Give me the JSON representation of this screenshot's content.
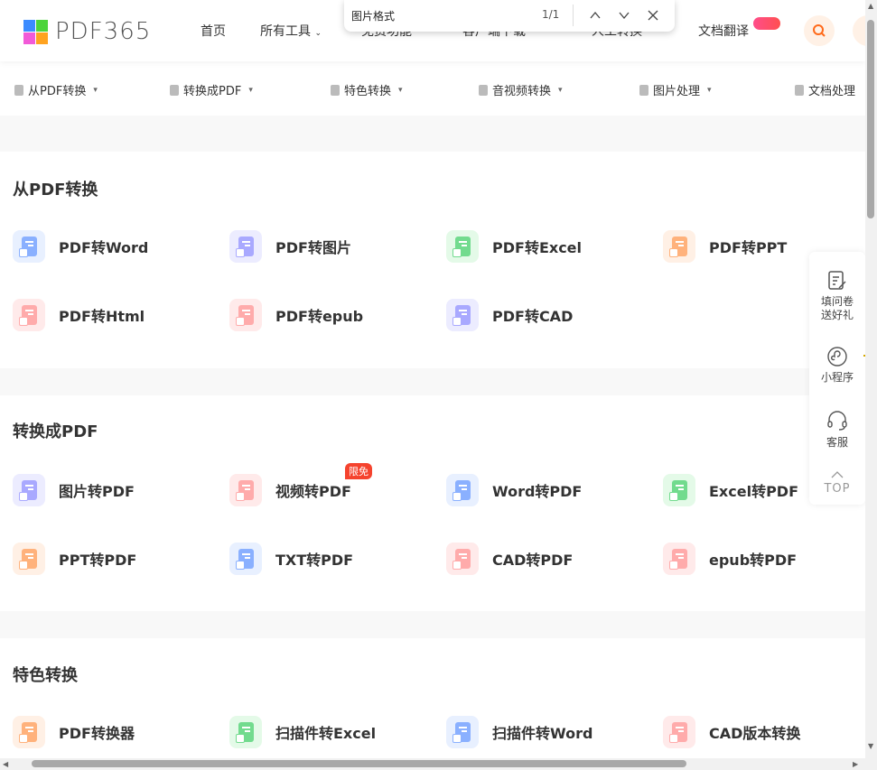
{
  "header": {
    "logo": "PDF365",
    "nav": [
      "首页",
      "所有工具",
      "免费功能",
      "客户端下载",
      "人工转换",
      "文档翻译"
    ]
  },
  "findbar": {
    "query": "图片格式",
    "count": "1/1"
  },
  "subnav": [
    "从PDF转换",
    "转换成PDF",
    "特色转换",
    "音视频转换",
    "图片处理",
    "文档处理"
  ],
  "sections": [
    {
      "title": "从PDF转换",
      "items": [
        {
          "label": "PDF转Word",
          "bg": "#e8f0ff",
          "fg": "#8ab0ff"
        },
        {
          "label": "PDF转图片",
          "bg": "#ececff",
          "fg": "#a9a9ff"
        },
        {
          "label": "PDF转Excel",
          "bg": "#e4fae8",
          "fg": "#72db8e"
        },
        {
          "label": "PDF转PPT",
          "bg": "#fff0e5",
          "fg": "#ffb27c"
        },
        {
          "label": "PDF转Html",
          "bg": "#ffeaea",
          "fg": "#ffabab"
        },
        {
          "label": "PDF转epub",
          "bg": "#ffeaea",
          "fg": "#ffabab"
        },
        {
          "label": "PDF转CAD",
          "bg": "#ececff",
          "fg": "#a9a9ff"
        }
      ]
    },
    {
      "title": "转换成PDF",
      "items": [
        {
          "label": "图片转PDF",
          "bg": "#ececff",
          "fg": "#a9a9ff"
        },
        {
          "label": "视频转PDF",
          "bg": "#ffeaea",
          "fg": "#ffabab",
          "badge": "限免"
        },
        {
          "label": "Word转PDF",
          "bg": "#e8f0ff",
          "fg": "#8ab0ff"
        },
        {
          "label": "Excel转PDF",
          "bg": "#e4fae8",
          "fg": "#72db8e"
        },
        {
          "label": "PPT转PDF",
          "bg": "#fff0e5",
          "fg": "#ffb27c"
        },
        {
          "label": "TXT转PDF",
          "bg": "#e8f0ff",
          "fg": "#8ab0ff"
        },
        {
          "label": "CAD转PDF",
          "bg": "#ffeaea",
          "fg": "#ffabab"
        },
        {
          "label": "epub转PDF",
          "bg": "#ffeaea",
          "fg": "#ffabab"
        }
      ]
    },
    {
      "title": "特色转换",
      "items": [
        {
          "label": "PDF转换器",
          "bg": "#fff0e5",
          "fg": "#ffb27c"
        },
        {
          "label": "扫描件转Excel",
          "bg": "#e4fae8",
          "fg": "#72db8e"
        },
        {
          "label": "扫描件转Word",
          "bg": "#e8f0ff",
          "fg": "#8ab0ff"
        },
        {
          "label": "CAD版本转换",
          "bg": "#ffeaea",
          "fg": "#ffabab"
        }
      ]
    }
  ],
  "side": [
    {
      "label": "填问卷\n送好礼",
      "icon": "survey-icon"
    },
    {
      "label": "小程序",
      "icon": "mini-program-icon"
    },
    {
      "label": "客服",
      "icon": "headset-icon"
    },
    {
      "label": "TOP",
      "icon": "chevron-up-icon"
    }
  ],
  "colors": {
    "accent": "#ff6a1a",
    "badge": "#f5432e"
  }
}
